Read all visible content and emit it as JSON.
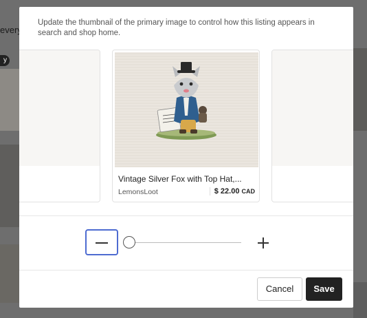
{
  "background": {
    "partial_text": "every",
    "badge_text": "y"
  },
  "modal": {
    "description": "Update the thumbnail of the primary image to control how this listing appears in search and shop home.",
    "listing": {
      "title": "Vintage Silver Fox with Top Hat,...",
      "shop_name": "LemonsLoot",
      "price": "$ 22.00",
      "currency": "CAD",
      "image": "fox-figurine-photo"
    },
    "zoom": {
      "zoom_out_icon": "minus-icon",
      "zoom_in_icon": "plus-icon",
      "level_fraction": 0
    },
    "actions": {
      "cancel_label": "Cancel",
      "save_label": "Save"
    }
  },
  "colors": {
    "focus_ring": "#4d6bd1",
    "save_button": "#222222"
  }
}
